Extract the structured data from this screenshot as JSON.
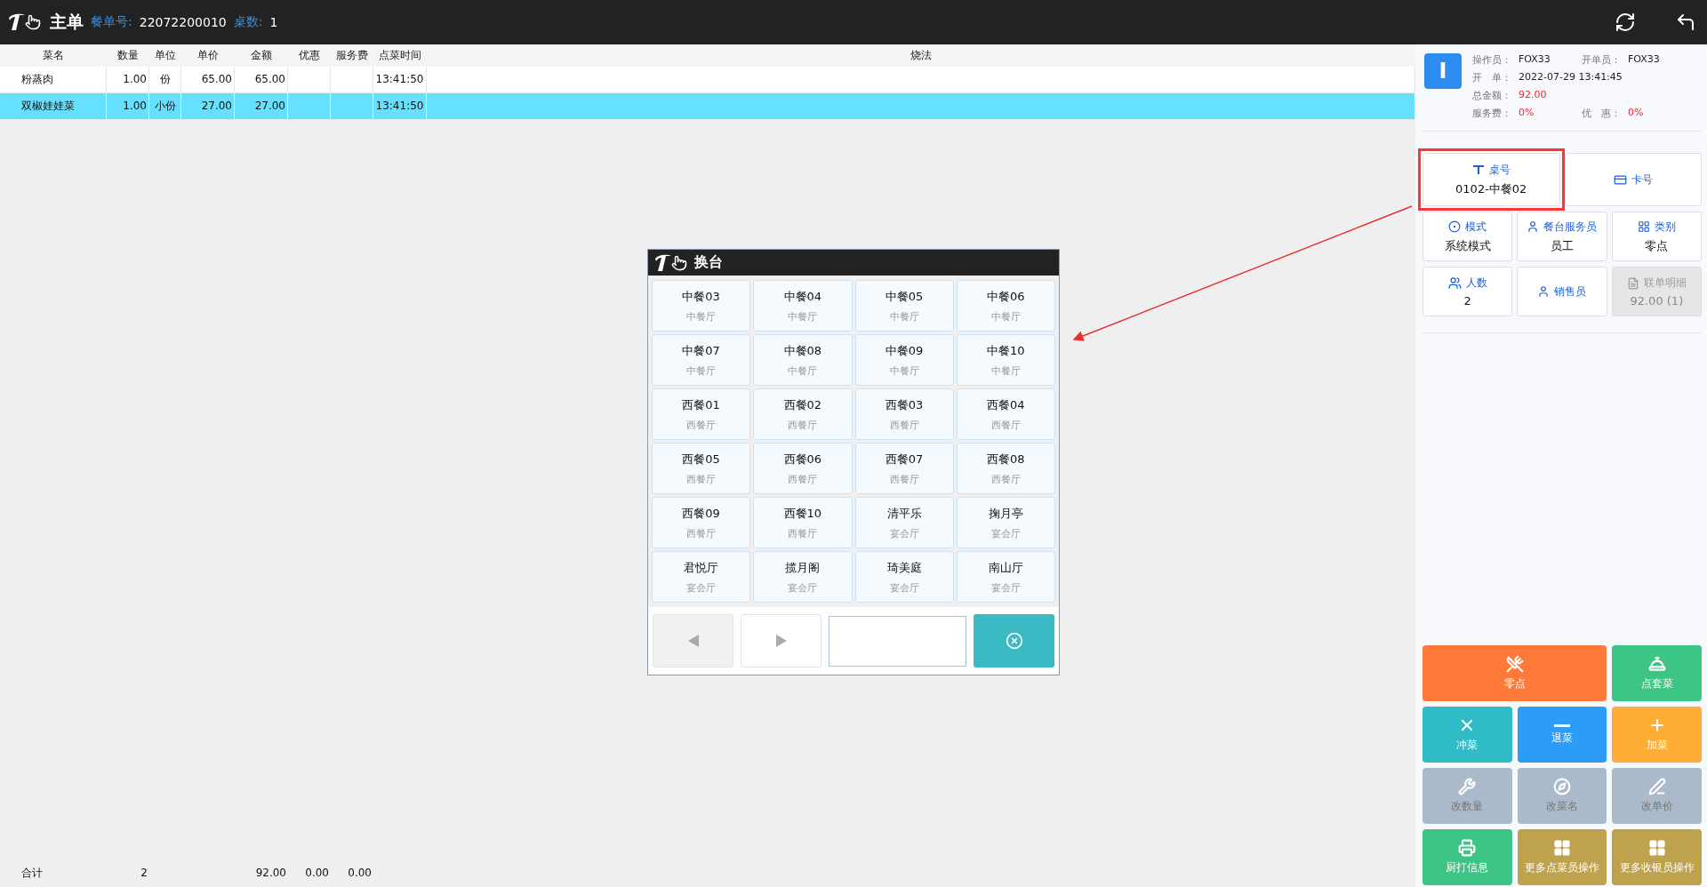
{
  "header": {
    "title": "主单",
    "order_label": "餐单号:",
    "order_no": "22072200010",
    "tables_label": "桌数:",
    "tables_count": "1"
  },
  "table": {
    "columns": [
      "菜名",
      "数量",
      "单位",
      "单价",
      "金额",
      "优惠",
      "服务费",
      "点菜时间",
      "烧法"
    ],
    "rows": [
      {
        "selected": false,
        "cells": [
          "粉蒸肉",
          "1.00",
          "份",
          "65.00",
          "65.00",
          "",
          "",
          "13:41:50",
          ""
        ]
      },
      {
        "selected": true,
        "cells": [
          "双椒娃娃菜",
          "1.00",
          "小份",
          "27.00",
          "27.00",
          "",
          "",
          "13:41:50",
          ""
        ]
      }
    ]
  },
  "totals": {
    "label": "合计",
    "quantity": "2",
    "amount": "92.00",
    "discount": "0.00",
    "service_fee": "0.00"
  },
  "info": {
    "badge": "I",
    "rows": [
      [
        {
          "label": "操作员：",
          "value": "FOX33",
          "emphasis": false
        },
        {
          "label": "开单员：",
          "value": "FOX33",
          "emphasis": false
        }
      ],
      [
        {
          "label": "开　单：",
          "value": "2022-07-29 13:41:45",
          "emphasis": false
        }
      ],
      [
        {
          "label": "总金额：",
          "value": "92.00",
          "emphasis": true
        }
      ],
      [
        {
          "label": "服务费：",
          "value": "0%",
          "emphasis": true
        },
        {
          "label": "优　惠：",
          "value": "0%",
          "emphasis": true
        }
      ]
    ]
  },
  "info_buttons": [
    [
      {
        "kind": "table",
        "label": "桌号",
        "value": "0102-中餐02",
        "disabled": false,
        "highlighted": true
      },
      {
        "kind": "card",
        "label": "卡号",
        "disabled": false
      }
    ],
    [
      {
        "kind": "mode",
        "label": "模式",
        "value": "系统模式",
        "disabled": false
      },
      {
        "kind": "person",
        "label": "餐台服务员",
        "value": "员工",
        "disabled": false
      },
      {
        "kind": "grid",
        "label": "类别",
        "value": "零点",
        "disabled": false
      }
    ],
    [
      {
        "kind": "people",
        "label": "人数",
        "value": "2",
        "disabled": false
      },
      {
        "kind": "person",
        "label": "销售员",
        "disabled": false
      },
      {
        "kind": "document",
        "label": "联单明细",
        "value": "92.00 (1)",
        "disabled": true
      }
    ]
  ],
  "actions": [
    {
      "kind": "cutlery",
      "label": "零点",
      "color": "#ff7a3a",
      "wide": true,
      "disabled": false
    },
    {
      "kind": "dome",
      "label": "点套菜",
      "color": "#3cc585",
      "wide": false,
      "disabled": false
    },
    {
      "kind": "cross",
      "label": "冲菜",
      "color": "#2fbcc6",
      "wide": false,
      "disabled": false
    },
    {
      "kind": "minus",
      "label": "退菜",
      "color": "#2d9cf7",
      "wide": false,
      "disabled": false
    },
    {
      "kind": "plus",
      "label": "加菜",
      "color": "#ffae35",
      "wide": false,
      "disabled": false
    },
    {
      "kind": "wrench",
      "label": "改数量",
      "color": "#aabacb",
      "wide": false,
      "disabled": true
    },
    {
      "kind": "compass",
      "label": "改菜名",
      "color": "#aabacb",
      "wide": false,
      "disabled": true
    },
    {
      "kind": "pen",
      "label": "改单价",
      "color": "#aabacb",
      "wide": false,
      "disabled": true
    },
    {
      "kind": "printer",
      "label": "厨打信息",
      "color": "#3cc585",
      "wide": false,
      "disabled": false
    },
    {
      "kind": "grid",
      "label": "更多点菜员操作",
      "color": "#bfa24e",
      "wide": false,
      "disabled": false
    },
    {
      "kind": "grid",
      "label": "更多收银员操作",
      "color": "#bfa24e",
      "wide": false,
      "disabled": false
    }
  ],
  "dialog": {
    "title": "换台",
    "tables": [
      {
        "name": "中餐03",
        "area": "中餐厅"
      },
      {
        "name": "中餐04",
        "area": "中餐厅"
      },
      {
        "name": "中餐05",
        "area": "中餐厅"
      },
      {
        "name": "中餐06",
        "area": "中餐厅"
      },
      {
        "name": "中餐07",
        "area": "中餐厅"
      },
      {
        "name": "中餐08",
        "area": "中餐厅"
      },
      {
        "name": "中餐09",
        "area": "中餐厅"
      },
      {
        "name": "中餐10",
        "area": "中餐厅"
      },
      {
        "name": "西餐01",
        "area": "西餐厅"
      },
      {
        "name": "西餐02",
        "area": "西餐厅"
      },
      {
        "name": "西餐03",
        "area": "西餐厅"
      },
      {
        "name": "西餐04",
        "area": "西餐厅"
      },
      {
        "name": "西餐05",
        "area": "西餐厅"
      },
      {
        "name": "西餐06",
        "area": "西餐厅"
      },
      {
        "name": "西餐07",
        "area": "西餐厅"
      },
      {
        "name": "西餐08",
        "area": "西餐厅"
      },
      {
        "name": "西餐09",
        "area": "西餐厅"
      },
      {
        "name": "西餐10",
        "area": "西餐厅"
      },
      {
        "name": "清平乐",
        "area": "宴会厅"
      },
      {
        "name": "掬月亭",
        "area": "宴会厅"
      },
      {
        "name": "君悦厅",
        "area": "宴会厅"
      },
      {
        "name": "揽月阁",
        "area": "宴会厅"
      },
      {
        "name": "琦美庭",
        "area": "宴会厅"
      },
      {
        "name": "南山厅",
        "area": "宴会厅"
      }
    ],
    "prev_disabled": true,
    "next_disabled": false
  }
}
